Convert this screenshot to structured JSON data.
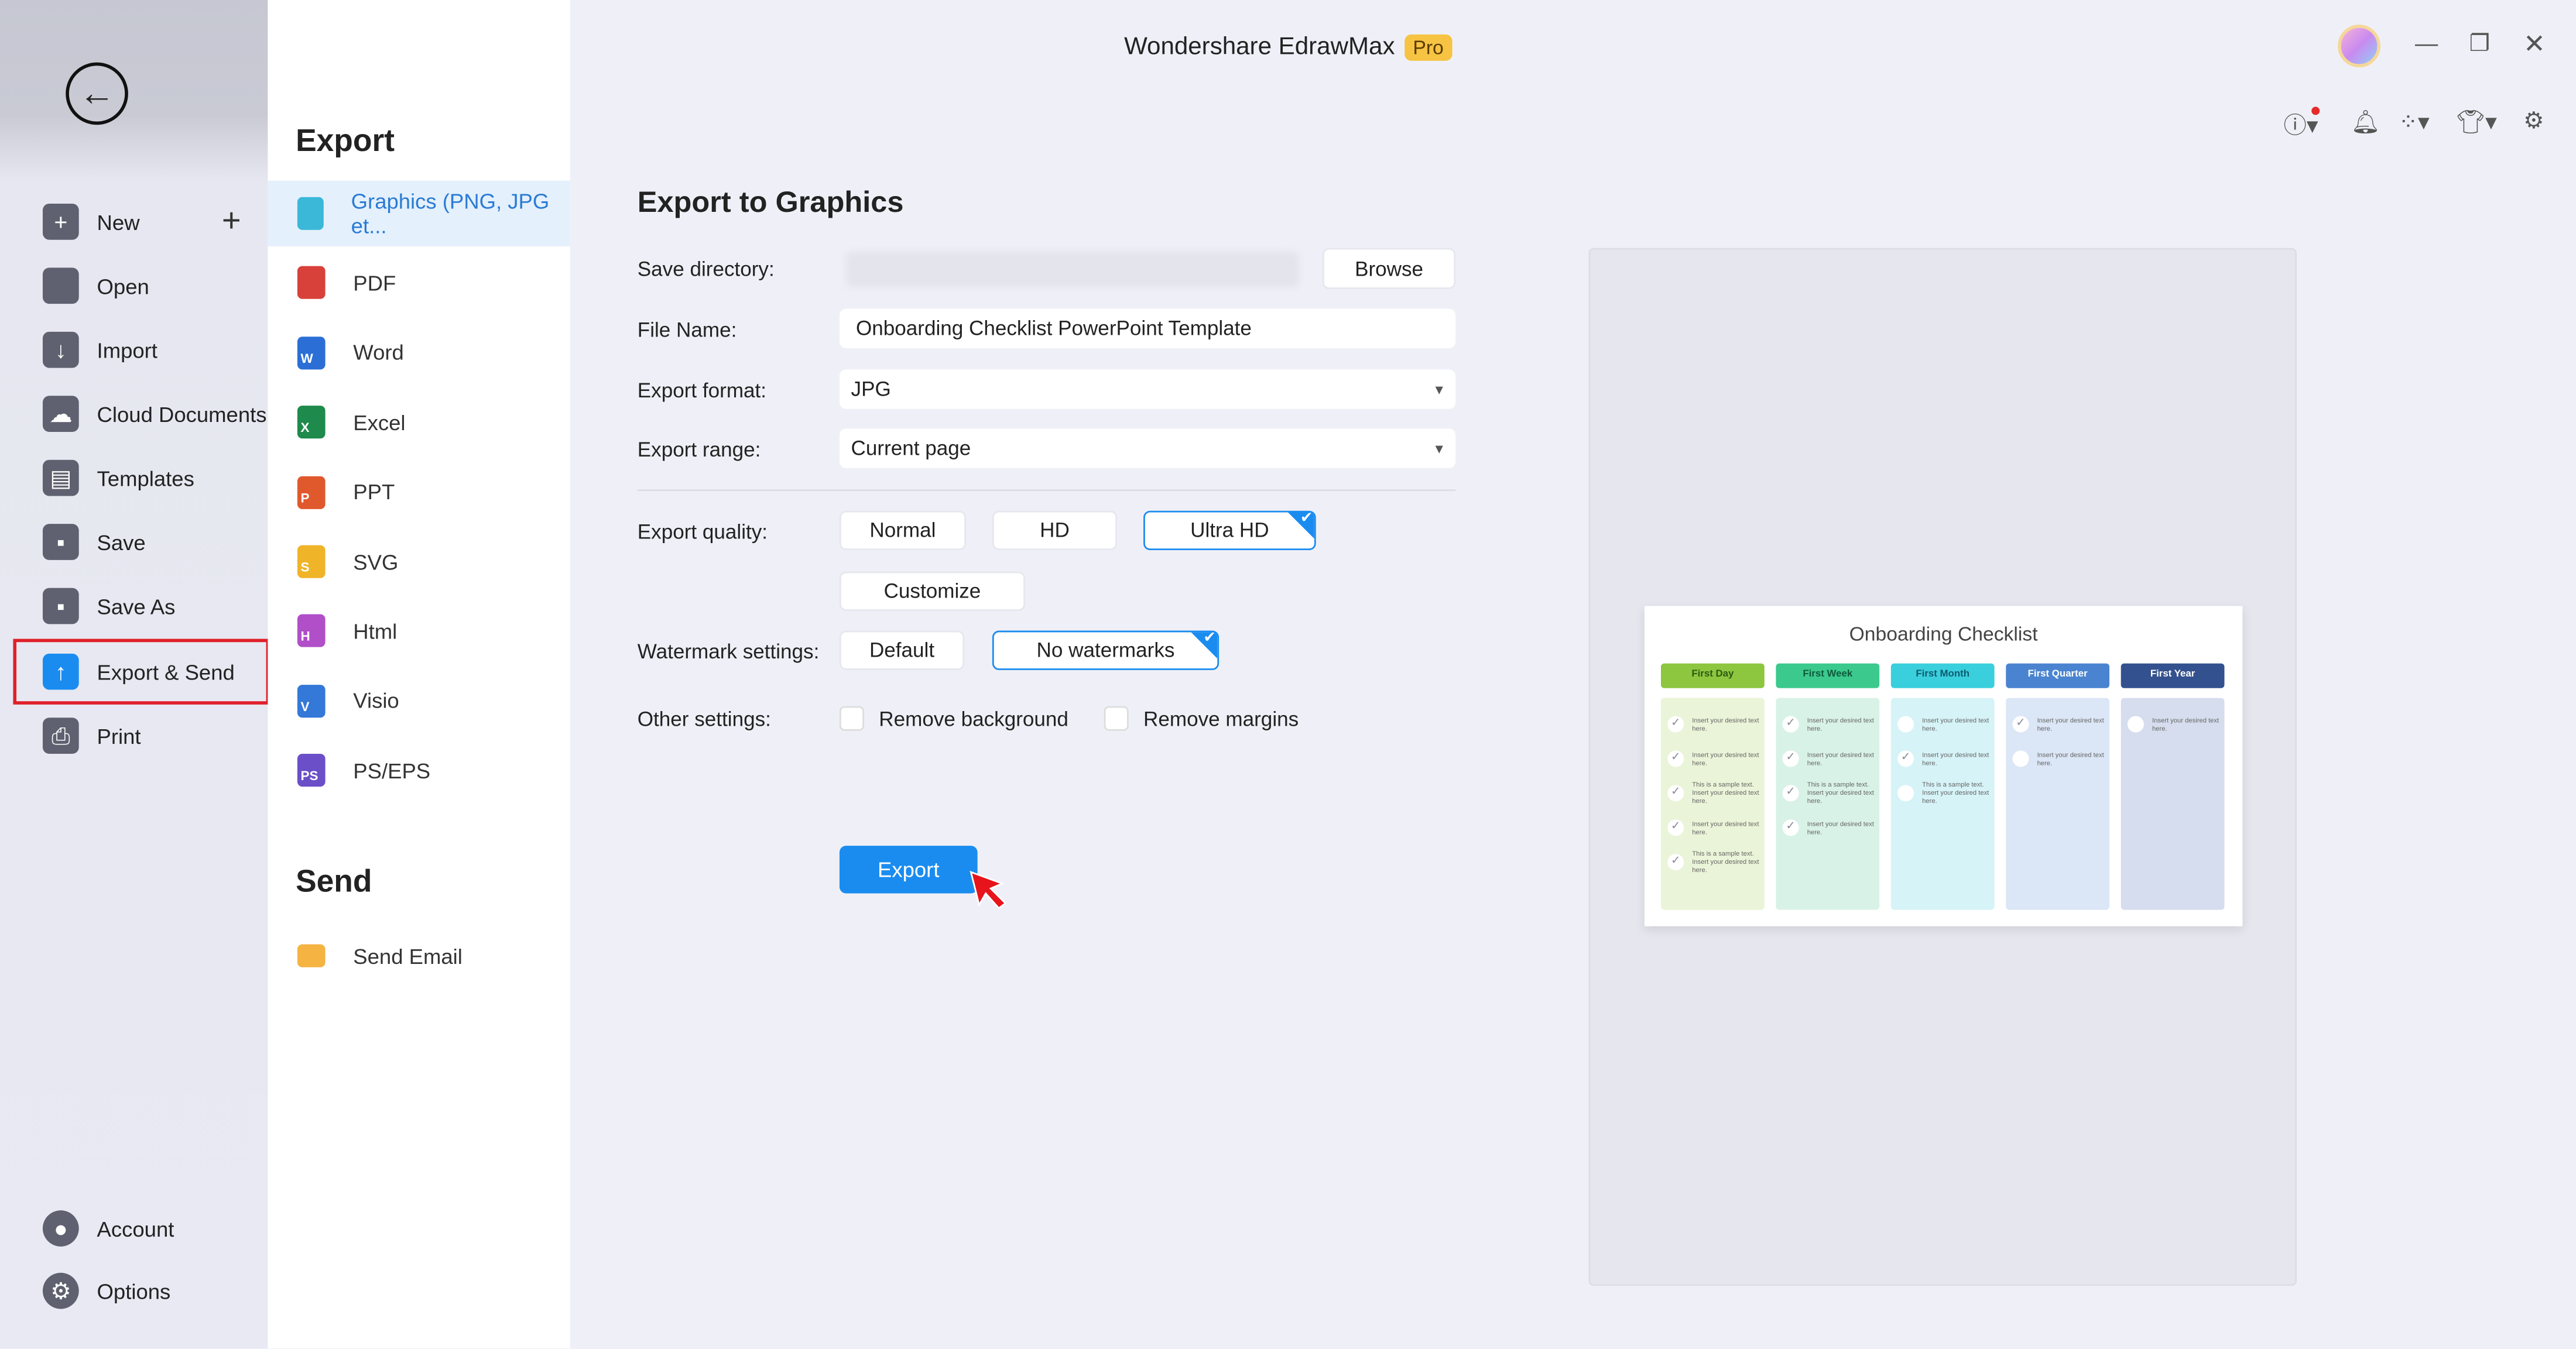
{
  "window": {
    "title": "Wondershare EdrawMax",
    "badge": "Pro"
  },
  "sidebar": {
    "items": [
      {
        "label": "New",
        "icon": "plus-square-icon"
      },
      {
        "label": "Open",
        "icon": "folder-icon"
      },
      {
        "label": "Import",
        "icon": "import-icon"
      },
      {
        "label": "Cloud Documents",
        "icon": "cloud-icon"
      },
      {
        "label": "Templates",
        "icon": "templates-icon"
      },
      {
        "label": "Save",
        "icon": "save-icon"
      },
      {
        "label": "Save As",
        "icon": "save-as-icon"
      },
      {
        "label": "Export & Send",
        "icon": "export-icon",
        "active": true
      },
      {
        "label": "Print",
        "icon": "print-icon"
      }
    ],
    "bottom": [
      {
        "label": "Account",
        "icon": "account-icon"
      },
      {
        "label": "Options",
        "icon": "gear-icon"
      }
    ]
  },
  "export_menu": {
    "heading": "Export",
    "items": [
      {
        "label": "Graphics (PNG, JPG et...",
        "color": "#3bb8d8",
        "letter": ""
      },
      {
        "label": "PDF",
        "color": "#d8413a",
        "letter": ""
      },
      {
        "label": "Word",
        "color": "#2b6fd6",
        "letter": "W"
      },
      {
        "label": "Excel",
        "color": "#1e8a4c",
        "letter": "X"
      },
      {
        "label": "PPT",
        "color": "#e0592c",
        "letter": "P"
      },
      {
        "label": "SVG",
        "color": "#f0b429",
        "letter": "S"
      },
      {
        "label": "Html",
        "color": "#b04fc8",
        "letter": "H"
      },
      {
        "label": "Visio",
        "color": "#3478d8",
        "letter": "V"
      },
      {
        "label": "PS/EPS",
        "color": "#6a4fc8",
        "letter": "PS"
      }
    ],
    "send_heading": "Send",
    "send_items": [
      {
        "label": "Send Email",
        "color": "#f5b342"
      }
    ]
  },
  "form": {
    "title": "Export to Graphics",
    "save_directory_label": "Save directory:",
    "browse": "Browse",
    "file_name_label": "File Name:",
    "file_name": "Onboarding Checklist PowerPoint Template",
    "format_label": "Export format:",
    "format": "JPG",
    "range_label": "Export range:",
    "range": "Current page",
    "quality_label": "Export quality:",
    "quality_options": [
      "Normal",
      "HD",
      "Ultra HD"
    ],
    "quality_selected": "Ultra HD",
    "customize": "Customize",
    "watermark_label": "Watermark settings:",
    "watermark_options": [
      "Default",
      "No watermarks"
    ],
    "watermark_selected": "No watermarks",
    "other_label": "Other settings:",
    "remove_background": "Remove background",
    "remove_background_checked": false,
    "remove_margins": "Remove margins",
    "remove_margins_checked": false,
    "export_button": "Export",
    "accent": "#1a8cf0"
  },
  "preview": {
    "title": "Onboarding Checklist",
    "columns": [
      {
        "name": "First Day",
        "head": "#8dc63f",
        "body": "#eaf4d8",
        "text": "#2d5a10",
        "items": [
          [
            "Insert your desired text here.",
            true
          ],
          [
            "Insert your desired text here.",
            true
          ],
          [
            "This is a sample text. Insert your desired text here.",
            true
          ],
          [
            "Insert your desired text here.",
            true
          ],
          [
            "This is a sample text. Insert your desired text here.",
            true
          ]
        ]
      },
      {
        "name": "First Week",
        "head": "#3cc98e",
        "body": "#d9f2e8",
        "text": "#0d5a3a",
        "items": [
          [
            "Insert your desired text here.",
            true
          ],
          [
            "Insert your desired text here.",
            true
          ],
          [
            "This is a sample text. Insert your desired text here.",
            true
          ],
          [
            "Insert your desired text here.",
            true
          ]
        ]
      },
      {
        "name": "First Month",
        "head": "#3acfdc",
        "body": "#d6f3f7",
        "text": "#0d5a70",
        "items": [
          [
            "Insert your desired text here.",
            false
          ],
          [
            "Insert your desired text here.",
            true
          ],
          [
            "This is a sample text. Insert your desired text here.",
            false
          ]
        ]
      },
      {
        "name": "First Quarter",
        "head": "#4a84d0",
        "body": "#dbe6f6",
        "text": "#ffffff",
        "items": [
          [
            "Insert your desired text here.",
            true
          ],
          [
            "Insert your desired text here.",
            false
          ]
        ]
      },
      {
        "name": "First Year",
        "head": "#34518f",
        "body": "#d5ddee",
        "text": "#ffffff",
        "items": [
          [
            "Insert your desired text here.",
            false
          ]
        ]
      }
    ]
  }
}
